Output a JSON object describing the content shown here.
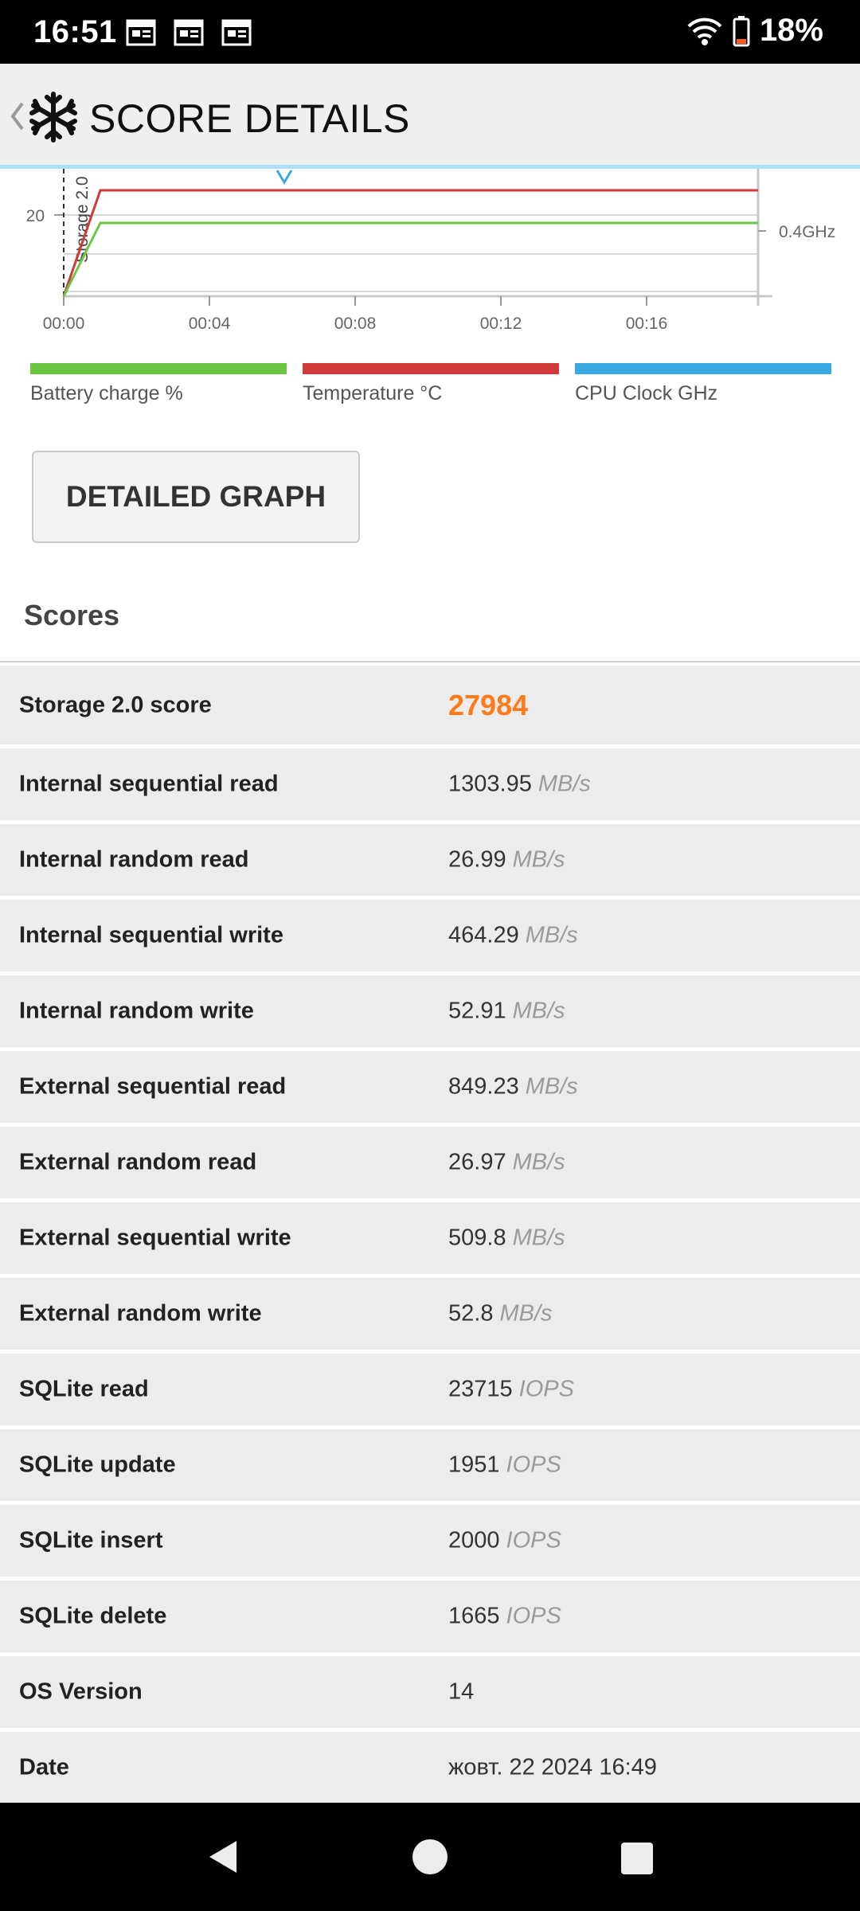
{
  "status_bar": {
    "time": "16:51",
    "battery_percent": "18%",
    "icons": [
      "calendar-icon",
      "calendar-icon",
      "calendar-icon",
      "wifi-icon",
      "battery-icon"
    ]
  },
  "header": {
    "title": "SCORE DETAILS",
    "back_icon": "chevron-left-icon",
    "app_icon": "snowflake-icon"
  },
  "chart_data": {
    "type": "line",
    "x_ticks": [
      "00:00",
      "00:04",
      "00:08",
      "00:12",
      "00:16"
    ],
    "left_ticks": [
      "20"
    ],
    "right_ticks": [
      "0.4GHz"
    ],
    "marker_label": "Storage 2.0",
    "series": [
      {
        "name": "Battery charge %",
        "color": "#6cc644"
      },
      {
        "name": "Temperature °C",
        "color": "#d03a3a"
      },
      {
        "name": "CPU Clock GHz",
        "color": "#3aa8e0"
      }
    ]
  },
  "legend": [
    {
      "label": "Battery charge %",
      "color": "#6cc644"
    },
    {
      "label": "Temperature °C",
      "color": "#d03a3a"
    },
    {
      "label": "CPU Clock GHz",
      "color": "#3aa8e0"
    }
  ],
  "detailed_graph_button": "DETAILED GRAPH",
  "scores_title": "Scores",
  "scores": [
    {
      "label": "Storage 2.0 score",
      "value": "27984",
      "unit": ""
    },
    {
      "label": "Internal sequential read",
      "value": "1303.95",
      "unit": "MB/s"
    },
    {
      "label": "Internal random read",
      "value": "26.99",
      "unit": "MB/s"
    },
    {
      "label": "Internal sequential write",
      "value": "464.29",
      "unit": "MB/s"
    },
    {
      "label": "Internal random write",
      "value": "52.91",
      "unit": "MB/s"
    },
    {
      "label": "External sequential read",
      "value": "849.23",
      "unit": "MB/s"
    },
    {
      "label": "External random read",
      "value": "26.97",
      "unit": "MB/s"
    },
    {
      "label": "External sequential write",
      "value": "509.8",
      "unit": "MB/s"
    },
    {
      "label": "External random write",
      "value": "52.8",
      "unit": "MB/s"
    },
    {
      "label": "SQLite read",
      "value": "23715",
      "unit": "IOPS"
    },
    {
      "label": "SQLite update",
      "value": "1951",
      "unit": "IOPS"
    },
    {
      "label": "SQLite insert",
      "value": "2000",
      "unit": "IOPS"
    },
    {
      "label": "SQLite delete",
      "value": "1665",
      "unit": "IOPS"
    },
    {
      "label": "OS Version",
      "value": "14",
      "unit": ""
    },
    {
      "label": "Date",
      "value": "жовт. 22 2024 16:49",
      "unit": ""
    }
  ],
  "nav": {
    "back": "nav-back-icon",
    "home": "nav-home-icon",
    "recents": "nav-recents-icon"
  }
}
